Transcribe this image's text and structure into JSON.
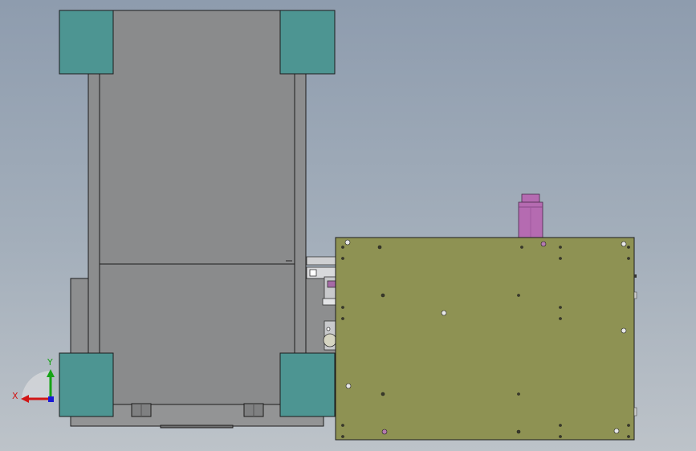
{
  "colors": {
    "viewport_top": "#8e9cae",
    "viewport_bottom": "#bdc3c9",
    "frame_body": "#8a8b8c",
    "frame_rail": "#8c8d8e",
    "corner_block": "#4d9592",
    "plate": "#8e9253",
    "motor": "#b56bb1",
    "outline": "#1c1c1c",
    "axis_x": "#d11515",
    "axis_y": "#16a316",
    "axis_z": "#1a1ad6"
  },
  "triad": {
    "x_label": "X",
    "y_label": "Y"
  },
  "icons": {
    "triad": "coordinate-triad-icon"
  }
}
